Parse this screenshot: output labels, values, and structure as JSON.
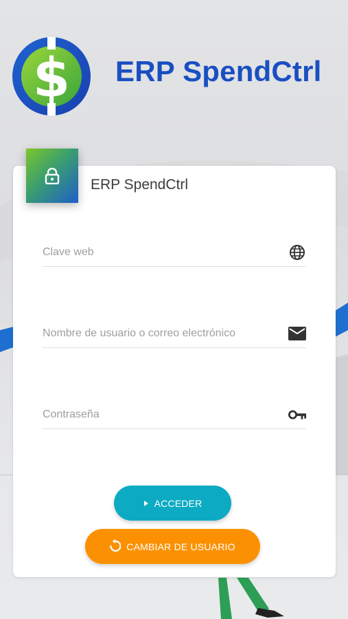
{
  "app": {
    "brand_title": "ERP SpendCtrl",
    "logo_symbol": "$"
  },
  "card": {
    "title": "ERP SpendCtrl"
  },
  "form": {
    "web_key": {
      "placeholder": "Clave web",
      "value": "",
      "icon": "globe-icon"
    },
    "username": {
      "placeholder": "Nombre de usuario o correo electrónico",
      "value": "",
      "icon": "mail-icon"
    },
    "password": {
      "placeholder": "Contraseña",
      "value": "",
      "icon": "key-icon"
    }
  },
  "actions": {
    "login_label": "ACCEDER",
    "change_user_label": "CAMBIAR DE USUARIO"
  },
  "colors": {
    "brand_blue": "#1a4fc2",
    "primary_button": "#0cabc3",
    "secondary_button": "#fb9102",
    "logo_green": "#7cc62a"
  }
}
